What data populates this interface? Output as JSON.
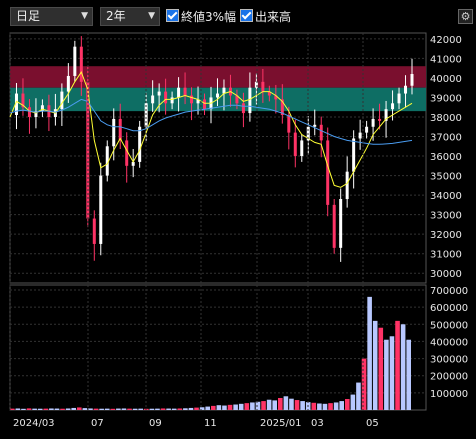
{
  "toolbar": {
    "period_select": "日足",
    "range_select": "2年",
    "check_band_label": "終値3%幅",
    "check_volume_label": "出来高"
  },
  "colors": {
    "band_upper": "#7a0f2e",
    "band_lower": "#0e6e64",
    "ma_short": "#ffff33",
    "ma_long": "#4a9cf0",
    "candle_up": "#ffffff",
    "candle_down": "#ff3366",
    "volume_bar": "#b8c8ff"
  },
  "chart_data": [
    {
      "type": "line",
      "title": "",
      "ylim": [
        29500,
        42300
      ],
      "y_ticks": [
        "42000",
        "41000",
        "40000",
        "39000",
        "38000",
        "37000",
        "36000",
        "35000",
        "34000",
        "33000",
        "32000",
        "31000",
        "30000"
      ],
      "x_ticks": [
        "2024/03",
        "07",
        "09",
        "11",
        "2025/01",
        "03",
        "05"
      ],
      "band": {
        "upper": [
          39500,
          40600
        ],
        "lower": [
          38300,
          39500
        ]
      },
      "series": [
        {
          "values": [
            38100,
            39200,
            38500,
            38000,
            38300,
            38600,
            38000,
            38400,
            39300,
            40100,
            41600,
            39800,
            32800,
            31500,
            35000,
            36500,
            37900,
            36800,
            35500,
            35700,
            37500,
            38700,
            39100,
            39300,
            38700,
            39000,
            39500,
            39100,
            38700,
            38900,
            38400,
            39000,
            39200,
            39500,
            39100,
            38700,
            38200,
            39500,
            39800,
            39300,
            39100,
            38900,
            38100,
            37200,
            36000,
            36800,
            37500,
            37600,
            36800,
            33500,
            31300,
            33800,
            35200,
            36900,
            37200,
            37500,
            37900,
            37800,
            38400,
            38700,
            39200,
            39600,
            40200
          ]
        },
        {
          "values": [
            38000,
            38800,
            38600,
            38300,
            38200,
            38400,
            38300,
            38200,
            38700,
            39200,
            39800,
            40300,
            39400,
            36800,
            35400,
            35600,
            36300,
            36900,
            36300,
            35700,
            36300,
            37200,
            38100,
            38600,
            38900,
            38900,
            39000,
            39100,
            39000,
            38900,
            38700,
            38700,
            38900,
            39200,
            39300,
            39100,
            38800,
            38900,
            39100,
            39300,
            39300,
            39100,
            38800,
            38300,
            37600,
            37100,
            36900,
            36700,
            36600,
            35500,
            34500,
            34400,
            34600,
            35200,
            35800,
            36400,
            37100,
            37500,
            37900,
            38100,
            38300,
            38500,
            38700
          ]
        },
        {
          "values": [
            38200,
            38300,
            38350,
            38300,
            38250,
            38300,
            38300,
            38250,
            38350,
            38500,
            38700,
            38900,
            38800,
            38300,
            37800,
            37600,
            37500,
            37500,
            37400,
            37300,
            37300,
            37400,
            37600,
            37800,
            37950,
            38050,
            38150,
            38250,
            38300,
            38350,
            38400,
            38450,
            38500,
            38550,
            38600,
            38600,
            38550,
            38550,
            38500,
            38450,
            38400,
            38300,
            38200,
            38050,
            37900,
            37750,
            37600,
            37450,
            37300,
            37150,
            37000,
            36900,
            36800,
            36750,
            36700,
            36650,
            36600,
            36600,
            36620,
            36650,
            36700,
            36750,
            36800
          ]
        }
      ]
    },
    {
      "type": "bar",
      "title": "",
      "ylim": [
        0,
        700000
      ],
      "y_ticks": [
        "700000",
        "600000",
        "500000",
        "400000",
        "300000",
        "200000",
        "100000"
      ],
      "values": [
        8000,
        9000,
        7000,
        9500,
        8000,
        7500,
        8000,
        9000,
        8500,
        7500,
        9000,
        12000,
        15000,
        11000,
        9000,
        8000,
        7500,
        8000,
        7000,
        8500,
        9000,
        8000,
        7500,
        8000,
        7000,
        7500,
        8000,
        9000,
        8500,
        8000,
        9000,
        10000,
        12000,
        14000,
        16000,
        20000,
        24000,
        28000,
        26000,
        30000,
        32000,
        36000,
        40000,
        44000,
        48000,
        52000,
        60000,
        56000,
        70000,
        80000,
        66000,
        58000,
        52000,
        46000,
        42000,
        38000,
        36000,
        40000,
        44000,
        52000,
        64000,
        90000,
        160000,
        300000,
        660000,
        520000,
        480000,
        410000,
        430000,
        520000,
        500000,
        410000
      ]
    }
  ]
}
